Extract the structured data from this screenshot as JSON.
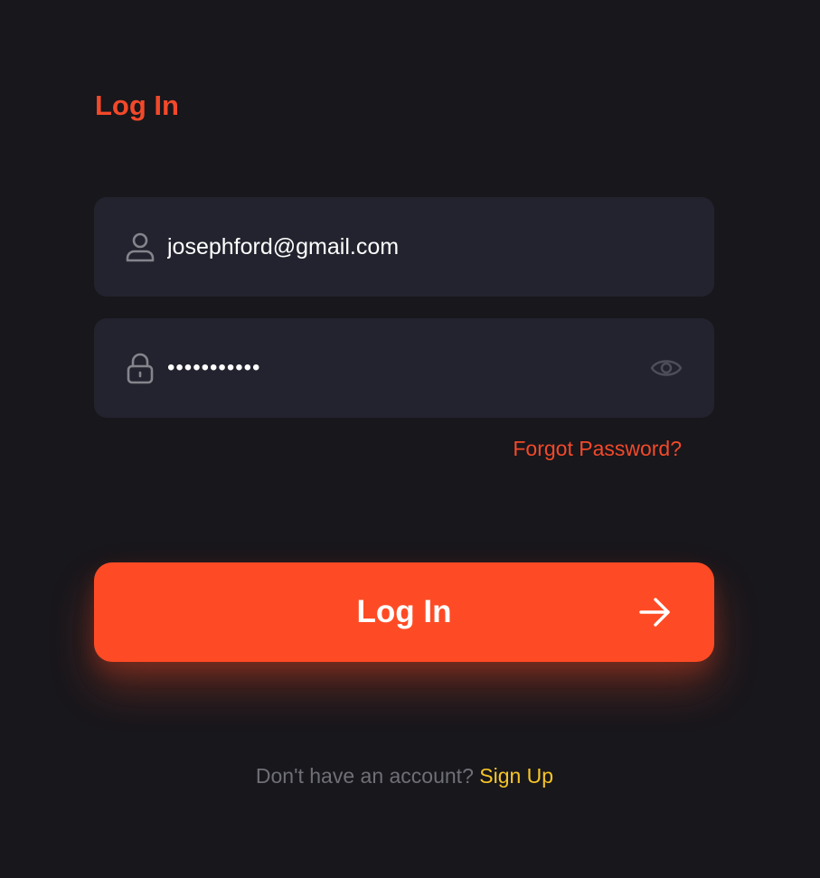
{
  "page": {
    "title": "Log In"
  },
  "email": {
    "value": "josephford@gmail.com",
    "icon": "user-icon"
  },
  "password": {
    "value": "•••••••••••",
    "icon": "lock-icon",
    "toggle_icon": "eye-icon"
  },
  "links": {
    "forgot_password": "Forgot Password?"
  },
  "login_button": {
    "label": "Log In",
    "icon": "arrow-right-icon"
  },
  "signup": {
    "prompt": "Don't have an account?",
    "link": "Sign Up"
  },
  "colors": {
    "background": "#18171c",
    "field_background": "#23232f",
    "accent": "#ff4b25",
    "title_and_link": "#f2492a",
    "signup_link": "#f5c528",
    "muted_text": "#6f6f77"
  }
}
